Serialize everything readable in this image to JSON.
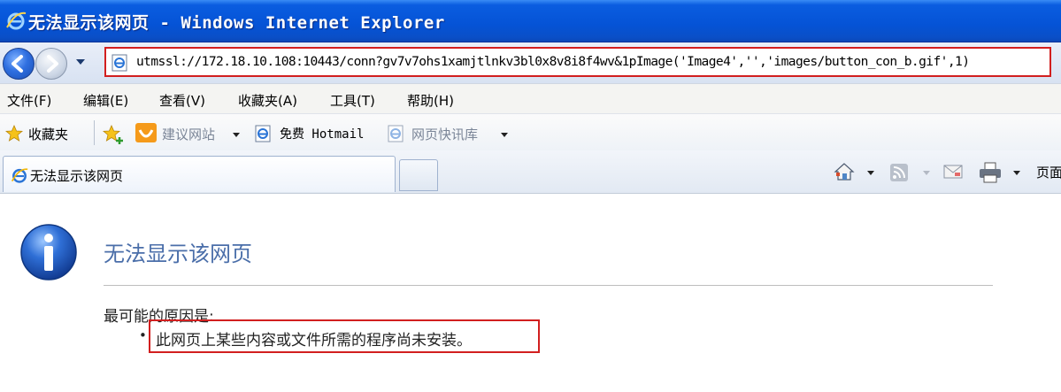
{
  "window": {
    "title": "无法显示该网页 - Windows Internet Explorer"
  },
  "address": {
    "url": "utmssl://172.18.10.108:10443/conn?gv7v7ohs1xamjtlnkv3bl0x8v8i8f4wv&1pImage('Image4','','images/button_con_b.gif',1)"
  },
  "menu": {
    "items": [
      "文件(F)",
      "编辑(E)",
      "查看(V)",
      "收藏夹(A)",
      "工具(T)",
      "帮助(H)"
    ]
  },
  "favorites": {
    "favorites_label": "收藏夹",
    "suggested_sites": "建议网站",
    "hotmail": "免费 Hotmail",
    "web_slice": "网页快讯库"
  },
  "tab": {
    "title": "无法显示该网页"
  },
  "commandbar": {
    "page_label": "页面"
  },
  "error": {
    "title": "无法显示该网页",
    "reason_heading": "最可能的原因是:",
    "bullet": "•",
    "reason": "此网页上某些内容或文件所需的程序尚未安装。"
  },
  "colors": {
    "titlebar": "#0553d6",
    "highlight_border": "#d21f1f",
    "error_title": "#4a6ea9"
  },
  "icons": [
    "ie-logo-icon",
    "back-icon",
    "forward-icon",
    "page-icon",
    "star-icon",
    "add-favorite-icon",
    "suggested-sites-icon",
    "home-icon",
    "rss-icon",
    "mail-icon",
    "print-icon",
    "info-icon"
  ]
}
